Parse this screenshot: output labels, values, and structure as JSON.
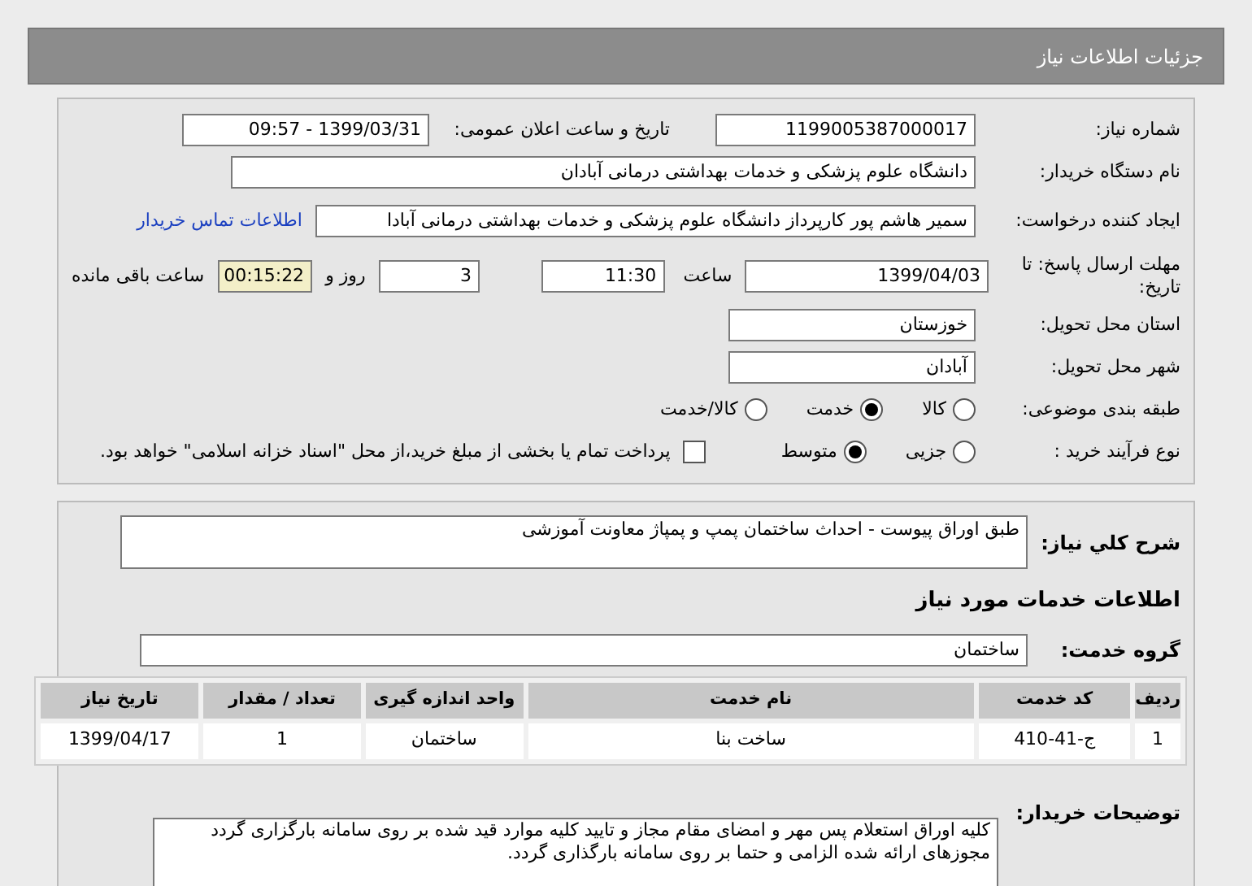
{
  "header": {
    "title": "جزئیات اطلاعات نیاز"
  },
  "need_number": {
    "label": "شماره نیاز:",
    "value": "1199005387000017"
  },
  "announce": {
    "label": "تاریخ و ساعت اعلان عمومی:",
    "value": "1399/03/31 - 09:57"
  },
  "buyer_org": {
    "label": "نام دستگاه خریدار:",
    "value": "دانشگاه علوم پزشکی و خدمات بهداشتی درمانی آبادان"
  },
  "requester": {
    "label": "ایجاد کننده درخواست:",
    "value": "سمیر هاشم پور کارپرداز دانشگاه علوم پزشکی و خدمات بهداشتی درمانی آبادا",
    "link": "اطلاعات تماس خریدار"
  },
  "deadline": {
    "label": "مهلت ارسال پاسخ: تا تاریخ:",
    "date": "1399/04/03",
    "time_label": "ساعت",
    "time": "11:30",
    "days": "3",
    "days_label": "روز و",
    "remaining": "00:15:22",
    "remaining_label": "ساعت باقی مانده"
  },
  "province": {
    "label": "استان محل تحویل:",
    "value": "خوزستان"
  },
  "city": {
    "label": "شهر محل تحویل:",
    "value": "آبادان"
  },
  "category": {
    "label": "طبقه بندی موضوعی:",
    "options": [
      {
        "label": "کالا",
        "selected": false
      },
      {
        "label": "خدمت",
        "selected": true
      },
      {
        "label": "کالا/خدمت",
        "selected": false
      }
    ]
  },
  "process": {
    "label": "نوع فرآیند خرید :",
    "options": [
      {
        "label": "جزیی",
        "selected": false
      },
      {
        "label": "متوسط",
        "selected": true
      }
    ],
    "payment": {
      "label": "پرداخت تمام یا بخشی از مبلغ خرید،از محل \"اسناد خزانه اسلامی\" خواهد بود.",
      "checked": false
    }
  },
  "summary": {
    "label": "شرح کلي نياز:",
    "value": "طبق اوراق پیوست - احداث ساختمان پمپ و پمپاژ معاونت آموزشی"
  },
  "services_heading": "اطلاعات خدمات مورد نیاز",
  "service_group": {
    "label": "گروه خدمت:",
    "value": "ساختمان"
  },
  "table": {
    "columns": [
      "ردیف",
      "کد خدمت",
      "نام خدمت",
      "واحد اندازه گیری",
      "تعداد / مقدار",
      "تاریخ نیاز"
    ],
    "rows": [
      [
        "1",
        "ج-41-410",
        "ساخت بنا",
        "ساختمان",
        "1",
        "1399/04/17"
      ]
    ]
  },
  "notes": {
    "label": "توضیحات خریدار:",
    "lines": [
      "کلیه اوراق استعلام پس مهر و امضای مقام مجاز و تایید کلیه موارد قید شده بر روی سامانه بارگزاری گردد",
      "مجوزهای ارائه شده الزامی و حتما بر روی سامانه بارگذاری گردد."
    ]
  }
}
